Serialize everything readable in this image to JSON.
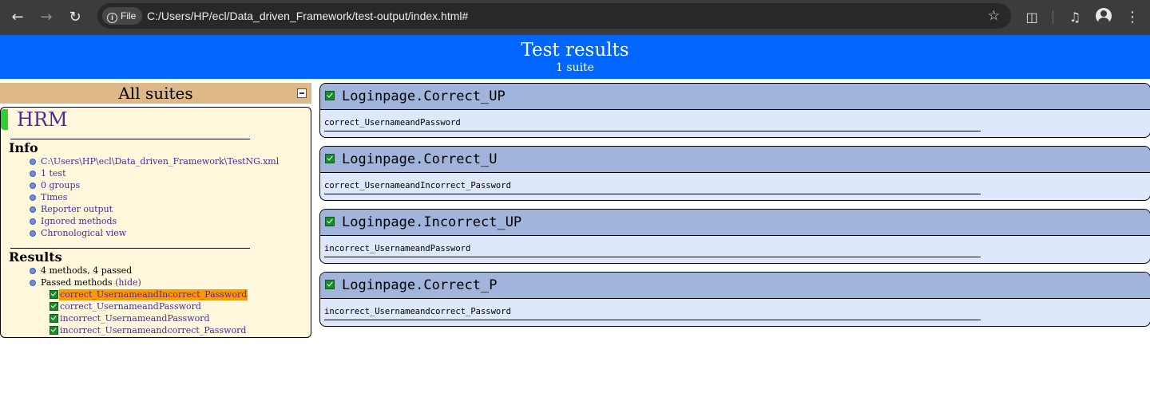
{
  "browser": {
    "chip_label": "File",
    "url": "C:/Users/HP/ecl/Data_driven_Framework/test-output/index.html#"
  },
  "banner": {
    "title": "Test results",
    "subtitle": "1 suite"
  },
  "sidebar": {
    "header": "All suites",
    "suite_name": "HRM",
    "info_title": "Info",
    "info_items": [
      "C:\\Users\\HP\\ecl\\Data_driven_Framework\\TestNG.xml",
      "1 test",
      "0 groups",
      "Times",
      "Reporter output",
      "Ignored methods",
      "Chronological view"
    ],
    "results_title": "Results",
    "summary": "4 methods, 4 passed",
    "passed_label": "Passed methods",
    "hide_label": "(hide)",
    "methods": [
      "correct_UsernameandIncorrect_Password",
      "correct_UsernameandPassword",
      "incorrect_UsernameandPassword",
      "incorrect_Usernameandcorrect_Password"
    ]
  },
  "main": {
    "classes": [
      {
        "title": "Loginpage.Correct_UP",
        "method": "correct_UsernameandPassword"
      },
      {
        "title": "Loginpage.Correct_U",
        "method": "correct_UsernameandIncorrect_Password"
      },
      {
        "title": "Loginpage.Incorrect_UP",
        "method": "incorrect_UsernameandPassword"
      },
      {
        "title": "Loginpage.Correct_P",
        "method": "incorrect_Usernameandcorrect_Password"
      }
    ]
  },
  "colors": {
    "banner": "#0066ff",
    "suite_header": "#deb887",
    "suite_panel": "#fff8dc",
    "selected_method": "#ff9900",
    "panel_header": "#a0b4dc",
    "panel_body": "#dde8fb",
    "pass_marker": "#33cc33"
  },
  "icons": [
    "back-arrow-icon",
    "forward-arrow-icon",
    "reload-icon",
    "info-icon",
    "star-icon",
    "extensions-icon",
    "media-icon",
    "profile-icon",
    "menu-icon",
    "collapse-icon",
    "checkbox-icon"
  ]
}
